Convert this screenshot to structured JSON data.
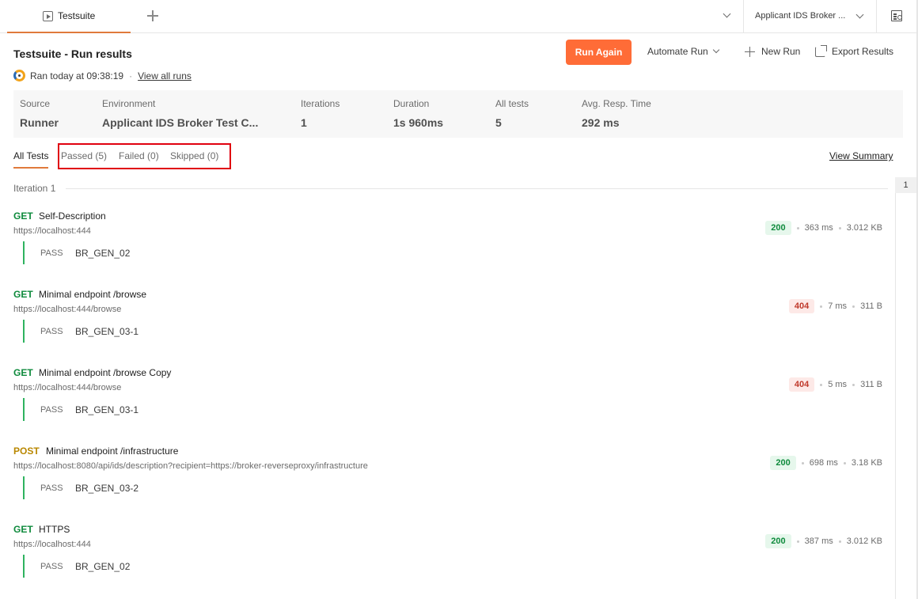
{
  "topbar": {
    "tab_label": "Testsuite",
    "environment": "Applicant IDS Broker ..."
  },
  "header": {
    "title": "Testsuite - Run results",
    "run_again": "Run Again",
    "automate_run": "Automate Run",
    "new_run": "New Run",
    "export_results": "Export Results",
    "ran_at": "Ran today at 09:38:19",
    "separator": "·",
    "view_all_runs": "View all runs"
  },
  "summary": {
    "source_label": "Source",
    "source": "Runner",
    "environment_label": "Environment",
    "environment": "Applicant IDS Broker Test C...",
    "iterations_label": "Iterations",
    "iterations": "1",
    "duration_label": "Duration",
    "duration": "1s 960ms",
    "all_tests_label": "All tests",
    "all_tests": "5",
    "avg_resp_label": "Avg. Resp. Time",
    "avg_resp": "292 ms"
  },
  "filters": {
    "all": "All Tests",
    "passed": "Passed (5)",
    "failed": "Failed (0)",
    "skipped": "Skipped (0)",
    "view_summary": "View Summary"
  },
  "iteration": {
    "label": "Iteration 1",
    "number": "1"
  },
  "requests": [
    {
      "method": "GET",
      "name": "Self-Description",
      "url": "https://localhost:444",
      "status": "200",
      "time": "363 ms",
      "size": "3.012 KB",
      "result": "PASS",
      "test": "BR_GEN_02"
    },
    {
      "method": "GET",
      "name": "Minimal endpoint /browse",
      "url": "https://localhost:444/browse",
      "status": "404",
      "time": "7 ms",
      "size": "311 B",
      "result": "PASS",
      "test": "BR_GEN_03-1"
    },
    {
      "method": "GET",
      "name": "Minimal endpoint /browse Copy",
      "url": "https://localhost:444/browse",
      "status": "404",
      "time": "5 ms",
      "size": "311 B",
      "result": "PASS",
      "test": "BR_GEN_03-1"
    },
    {
      "method": "POST",
      "name": "Minimal endpoint /infrastructure",
      "url": "https://localhost:8080/api/ids/description?recipient=https://broker-reverseproxy/infrastructure",
      "status": "200",
      "time": "698 ms",
      "size": "3.18 KB",
      "result": "PASS",
      "test": "BR_GEN_03-2"
    },
    {
      "method": "GET",
      "name": "HTTPS",
      "url": "https://localhost:444",
      "status": "200",
      "time": "387 ms",
      "size": "3.012 KB",
      "result": "PASS",
      "test": "BR_GEN_02"
    }
  ],
  "colors": {
    "accent": "#ff6c37",
    "get": "#0e8a3c",
    "post": "#b98700",
    "pass_bar": "#2eb35f",
    "highlight_box": "#e0000f"
  }
}
